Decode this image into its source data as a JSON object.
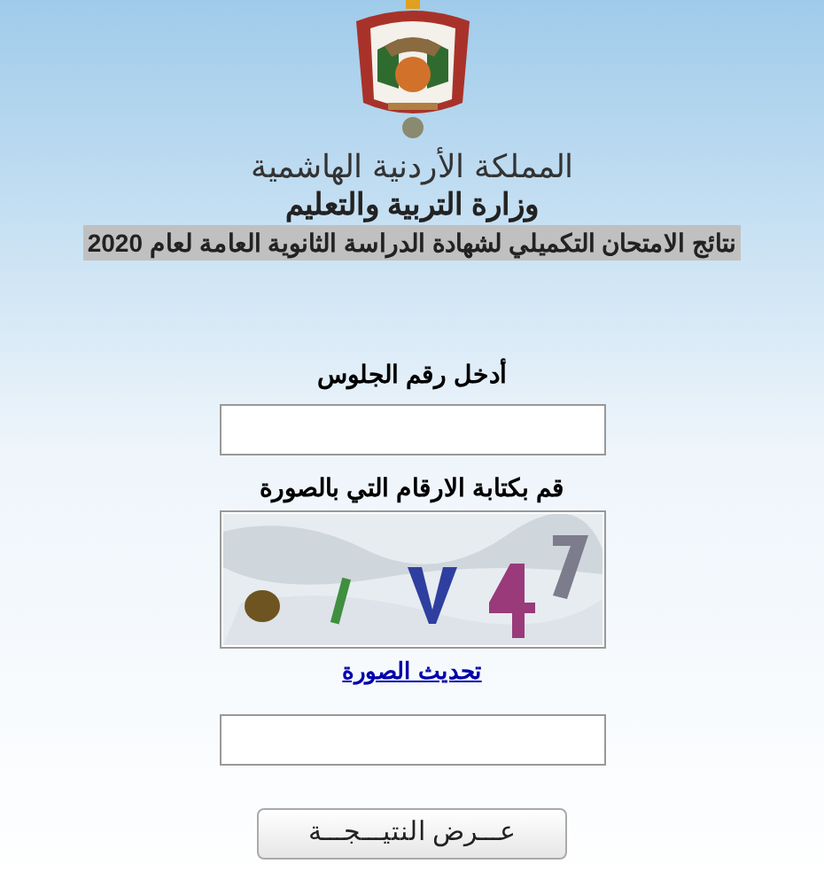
{
  "header": {
    "kingdom": "المملكة الأردنية الهاشمية",
    "ministry": "وزارة التربية والتعليم",
    "title": "نتائج الامتحان التكميلي لشهادة الدراسة الثانوية العامة لعام 2020"
  },
  "form": {
    "seat_label": "أدخل رقم الجلوس",
    "captcha_label": "قم بكتابة الارقام التي بالصورة",
    "refresh_link": "تحديث الصورة",
    "submit": "عـــرض النتيـــجـــة"
  }
}
